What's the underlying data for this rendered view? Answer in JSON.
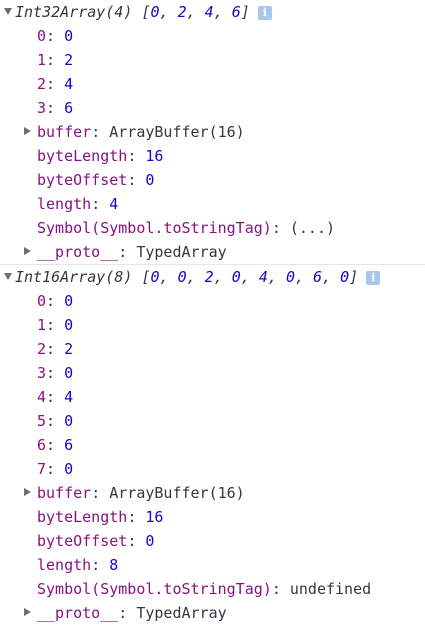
{
  "groups": [
    {
      "title": "Int32Array(4)",
      "preview": [
        "0",
        "2",
        "4",
        "6"
      ],
      "info_glyph": "i",
      "elements": [
        {
          "index": "0",
          "value": "0"
        },
        {
          "index": "1",
          "value": "2"
        },
        {
          "index": "2",
          "value": "4"
        },
        {
          "index": "3",
          "value": "6"
        }
      ],
      "buffer": {
        "key": "buffer",
        "value": "ArrayBuffer(16)"
      },
      "byteLength": {
        "key": "byteLength",
        "value": "16"
      },
      "byteOffset": {
        "key": "byteOffset",
        "value": "0"
      },
      "length": {
        "key": "length",
        "value": "4"
      },
      "toStringTag": {
        "key": "Symbol(Symbol.toStringTag)",
        "value": "(...)"
      },
      "proto": {
        "key": "__proto__",
        "value": "TypedArray"
      }
    },
    {
      "title": "Int16Array(8)",
      "preview": [
        "0",
        "0",
        "2",
        "0",
        "4",
        "0",
        "6",
        "0"
      ],
      "info_glyph": "i",
      "elements": [
        {
          "index": "0",
          "value": "0"
        },
        {
          "index": "1",
          "value": "0"
        },
        {
          "index": "2",
          "value": "2"
        },
        {
          "index": "3",
          "value": "0"
        },
        {
          "index": "4",
          "value": "4"
        },
        {
          "index": "5",
          "value": "0"
        },
        {
          "index": "6",
          "value": "6"
        },
        {
          "index": "7",
          "value": "0"
        }
      ],
      "buffer": {
        "key": "buffer",
        "value": "ArrayBuffer(16)"
      },
      "byteLength": {
        "key": "byteLength",
        "value": "16"
      },
      "byteOffset": {
        "key": "byteOffset",
        "value": "0"
      },
      "length": {
        "key": "length",
        "value": "8"
      },
      "toStringTag": {
        "key": "Symbol(Symbol.toStringTag)",
        "value": "undefined"
      },
      "proto": {
        "key": "__proto__",
        "value": "TypedArray"
      }
    }
  ],
  "colors": {
    "number": "#1c00cf",
    "key": "#881280",
    "text": "#303942",
    "info": "#a8c6ee"
  }
}
